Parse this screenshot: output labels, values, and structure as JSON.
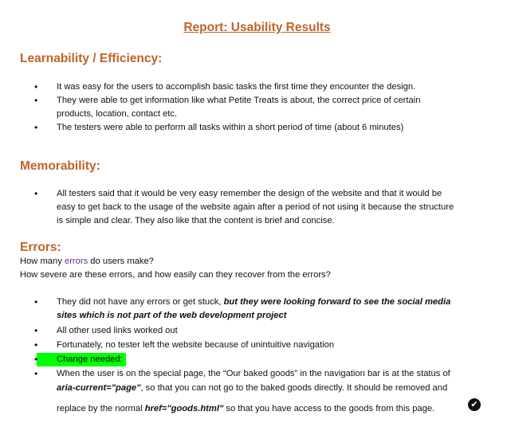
{
  "title": "Report: Usability Results",
  "learnability": {
    "heading": "Learnability / Efficiency:",
    "items": [
      "It was easy for the users to accomplish basic tasks the first time they encounter the design.",
      "They were able to get information like what Petite Treats is about, the correct price of certain",
      "products, location, contact etc.",
      "The testers were able to perform all tasks within a short period of time (about 6 minutes)"
    ]
  },
  "memorability": {
    "heading": "Memorability:",
    "lines": [
      "All testers said that it would be very easy remember the design of the website and that it would be",
      "easy to get back to the usage of the website again after a period of not using it because the structure",
      "is simple and clear. They also like that the content is brief and concise."
    ]
  },
  "errors": {
    "heading": "Errors:",
    "q1_a": "How many ",
    "q1_b": "errors",
    "q1_c": " do users make?",
    "q2": "How severe are these errors, and how easily can they recover from the errors?",
    "b1_a": "They did not have any errors or get stuck, ",
    "b1_b": "but they were looking forward to see the social media",
    "b1_c": "sites which is not part of the web development project",
    "b2": "All other used links worked out",
    "b3": "Fortunately, no tester left the website because of unintuitive navigation",
    "b4": "Change needed:",
    "b5_l1": "When the user is on the special page, the “Our baked goods” in the navigation bar is at the status of",
    "b5_l2a": "aria-current=\"page\"",
    "b5_l2b": ", so that you can not go to the baked goods directly. It should be removed and",
    "b5_l3a": "replace by the normal ",
    "b5_l3b": "href=\"goods.html\"",
    "b5_l3c": " so that you have access to the goods from this page."
  },
  "icons": {
    "bullet": "•",
    "check": "✔"
  },
  "colors": {
    "heading": "#c0632a",
    "highlight": "#00ff00",
    "link_word": "#6b2f8f"
  }
}
